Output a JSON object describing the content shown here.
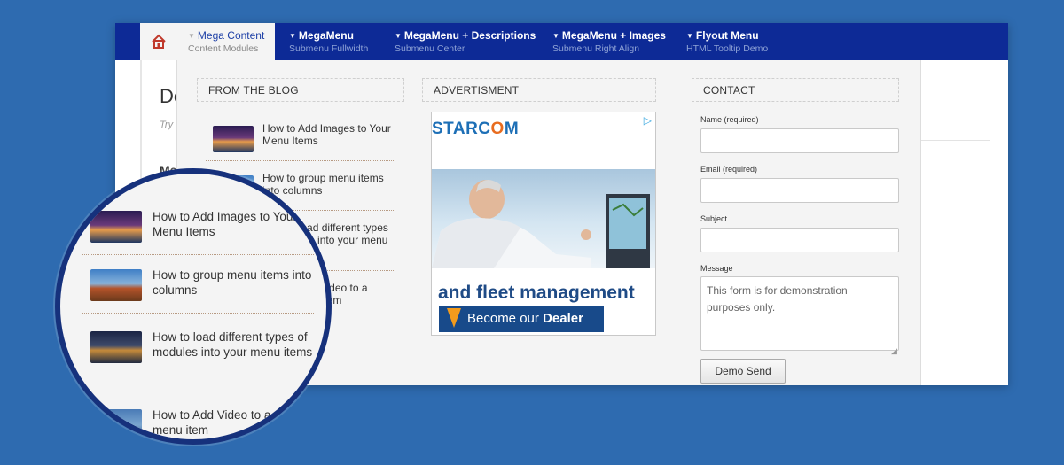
{
  "nav": {
    "items": [
      {
        "label": "Mega Content",
        "desc": "Content Modules",
        "active": true
      },
      {
        "label": "MegaMenu",
        "desc": "Submenu Fullwidth"
      },
      {
        "label": "MegaMenu + Descriptions",
        "desc": "Submenu Center"
      },
      {
        "label": "MegaMenu + Images",
        "desc": "Submenu Right Align"
      },
      {
        "label": "Flyout Menu",
        "desc": "HTML Tooltip Demo"
      }
    ],
    "colors": {
      "bar": "#0d2a96",
      "active_bg": "#f4f4f4",
      "accent_text": "#1d3fa6"
    }
  },
  "background_page": {
    "title": "De",
    "intro": "Try can",
    "subheading": "Me"
  },
  "dropdown": {
    "blog": {
      "heading": "FROM THE BLOG",
      "items": [
        {
          "title": "How to Add Images to Your Menu Items"
        },
        {
          "title": "How to group menu items into columns"
        },
        {
          "title": "How to load different types of modules into your menu items"
        },
        {
          "title": "How to Add Video to a mega menu item"
        }
      ]
    },
    "advertisement": {
      "heading": "ADVERTISMENT",
      "brand_pre": "STARC",
      "brand_o": "O",
      "brand_post": "M",
      "headline": "and fleet management",
      "cta_pre": "Become our ",
      "cta_bold": "Dealer"
    },
    "contact": {
      "heading": "CONTACT",
      "name_label": "Name (required)",
      "email_label": "Email (required)",
      "subject_label": "Subject",
      "message_label": "Message",
      "message_value": "This form is for demonstration purposes only.",
      "send_label": "Demo Send"
    }
  },
  "magnifier": {
    "items": [
      {
        "title": "How to Add Images to Your Menu Items"
      },
      {
        "title": "How to group menu items into columns"
      },
      {
        "title": "How to load different types of modules into your menu items"
      },
      {
        "title": "How to Add Video to a mega menu item"
      }
    ]
  }
}
